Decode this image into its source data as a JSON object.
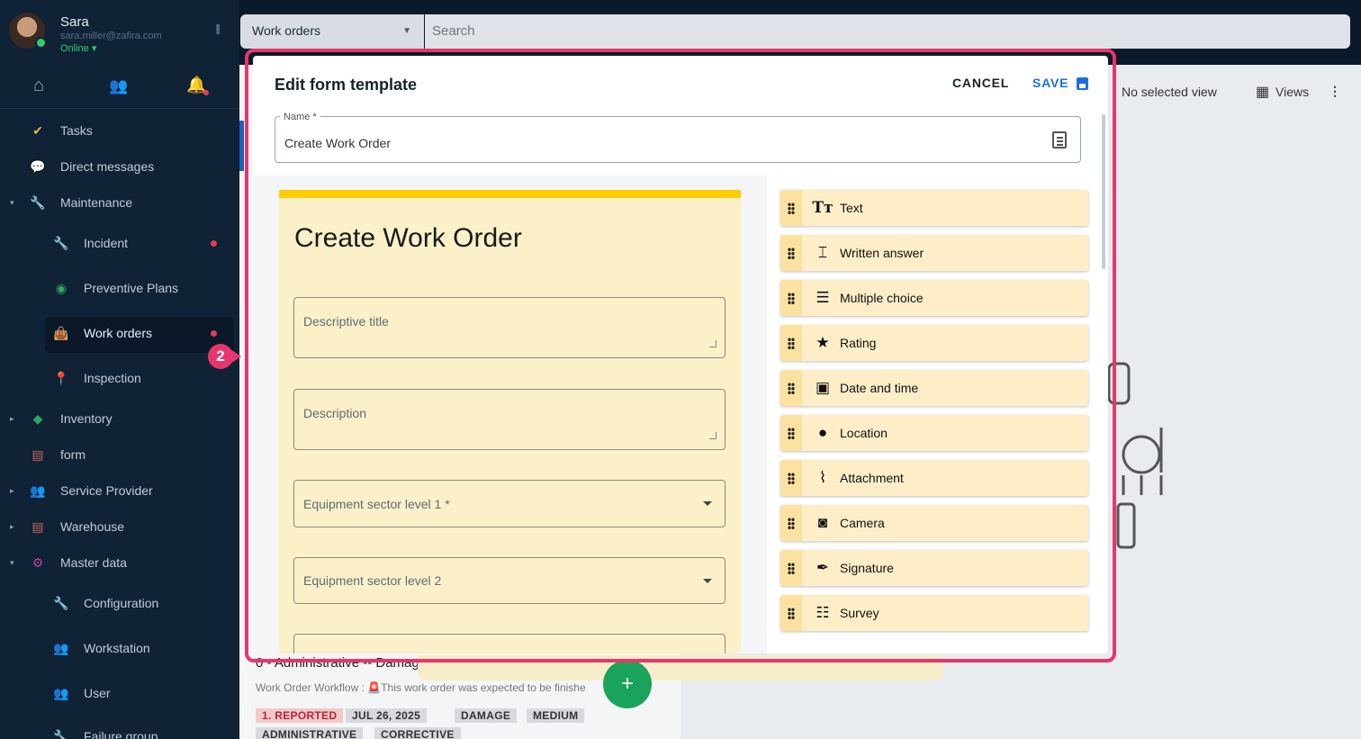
{
  "user": {
    "name": "Sara",
    "email": "sara.miller@zafira.com",
    "status": "Online"
  },
  "topbar": {
    "module": "Work orders",
    "search_placeholder": "Search"
  },
  "sidebar": {
    "items": [
      {
        "label": "Tasks"
      },
      {
        "label": "Direct messages"
      },
      {
        "label": "Maintenance"
      },
      {
        "label": "Incident"
      },
      {
        "label": "Preventive Plans"
      },
      {
        "label": "Work orders"
      },
      {
        "label": "Inspection"
      },
      {
        "label": "Inventory"
      },
      {
        "label": "form"
      },
      {
        "label": "Service Provider"
      },
      {
        "label": "Warehouse"
      },
      {
        "label": "Master data"
      },
      {
        "label": "Configuration"
      },
      {
        "label": "Workstation"
      },
      {
        "label": "User"
      },
      {
        "label": "Failure group"
      }
    ]
  },
  "background": {
    "view_label": "No selected view",
    "views_label": "Views",
    "card_title": "0 - Administrative -- Damag",
    "card_sub": "Work Order Workflow : 🚨This work order was expected to be finishe",
    "tags": [
      "1. REPORTED",
      "JUL 26, 2025",
      "DAMAGE",
      "MEDIUM",
      "ADMINISTRATIVE",
      "CORRECTIVE"
    ]
  },
  "step_badge": "2",
  "modal": {
    "title": "Edit form template",
    "cancel_label": "CANCEL",
    "save_label": "SAVE",
    "name_label": "Name *",
    "name_value": "Create Work Order",
    "preview_title": "Create Work Order",
    "fields": [
      {
        "placeholder": "Descriptive title"
      },
      {
        "placeholder": "Description"
      },
      {
        "placeholder": "Equipment sector level 1 *"
      },
      {
        "placeholder": "Equipment sector level 2"
      }
    ],
    "palette": [
      {
        "label": "Text",
        "icon": "text-icon"
      },
      {
        "label": "Written answer",
        "icon": "written-answer-icon"
      },
      {
        "label": "Multiple choice",
        "icon": "multiple-choice-icon"
      },
      {
        "label": "Rating",
        "icon": "star-icon"
      },
      {
        "label": "Date and time",
        "icon": "calendar-icon"
      },
      {
        "label": "Location",
        "icon": "location-pin-icon"
      },
      {
        "label": "Attachment",
        "icon": "paperclip-icon"
      },
      {
        "label": "Camera",
        "icon": "camera-icon"
      },
      {
        "label": "Signature",
        "icon": "pen-icon"
      },
      {
        "label": "Survey",
        "icon": "survey-icon"
      }
    ]
  },
  "colors": {
    "accent": "#1e6fd9",
    "highlight": "#e8356d",
    "preview_bar": "#ffcc00",
    "palette_bg": "#fdeec8"
  }
}
